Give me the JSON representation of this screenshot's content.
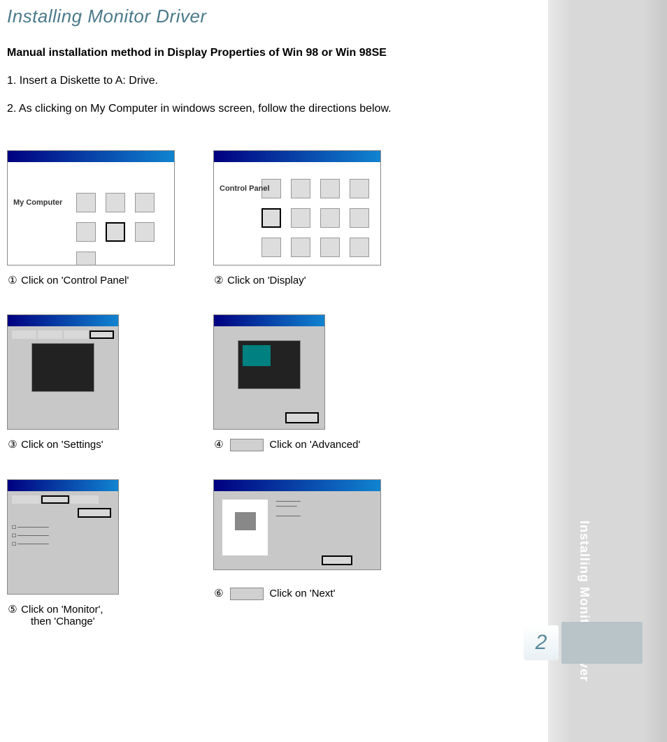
{
  "title": "Installing Monitor Driver",
  "subtitle": "Manual installation method in Display Properties of Win 98 or Win 98SE",
  "steps": {
    "s1": "1.  Insert a Diskette to A: Drive.",
    "s2": "2.  As clicking on My Computer in windows screen, follow the directions below."
  },
  "captions": {
    "c1_num": "①",
    "c1": "Click on 'Control Panel'",
    "c2_num": "②",
    "c2": "Click on 'Display'",
    "c3_num": "③",
    "c3": "Click on 'Settings'",
    "c4_num": "④",
    "c4": "Click on 'Advanced'",
    "c5_num": "⑤",
    "c5_line1": "Click on 'Monitor',",
    "c5_line2": "then 'Change'",
    "c6_num": "⑥",
    "c6": "Click  on 'Next'"
  },
  "labels": {
    "mycomputer": "My Computer",
    "controlpanel": "Control Panel"
  },
  "sidebar": {
    "text": "Installing Moniter Driver",
    "chapter": "2"
  }
}
